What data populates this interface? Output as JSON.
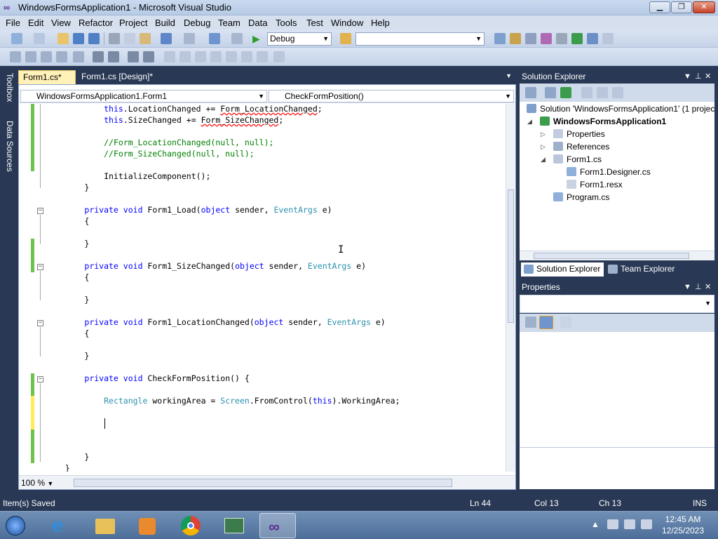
{
  "window": {
    "title": "WindowsFormsApplication1 - Microsoft Visual Studio"
  },
  "menu": [
    "File",
    "Edit",
    "View",
    "Refactor",
    "Project",
    "Build",
    "Debug",
    "Team",
    "Data",
    "Tools",
    "Test",
    "Window",
    "Help"
  ],
  "toolbar": {
    "config": "Debug",
    "platform": ""
  },
  "toolbox_strip": {
    "toolbox": "Toolbox",
    "data_sources": "Data Sources"
  },
  "tabs": [
    {
      "label": "Form1.cs*",
      "active": true
    },
    {
      "label": "Form1.cs [Design]*",
      "active": false
    }
  ],
  "navbar": {
    "type": "WindowsFormsApplication1.Form1",
    "member": "CheckFormPosition()"
  },
  "code": {
    "lines": [
      [
        [
          "            "
        ],
        [
          "this",
          "kw"
        ],
        [
          ".LocationChanged += "
        ],
        [
          "Form_LocationChanged",
          "sq"
        ],
        [
          ";"
        ]
      ],
      [
        [
          "            "
        ],
        [
          "this",
          "kw"
        ],
        [
          ".SizeChanged += "
        ],
        [
          "Form_SizeChanged",
          "sq"
        ],
        [
          ";"
        ]
      ],
      [
        [
          ""
        ]
      ],
      [
        [
          "            "
        ],
        [
          "//Form_LocationChanged(null, null);",
          "cm"
        ]
      ],
      [
        [
          "            "
        ],
        [
          "//Form_SizeChanged(null, null);",
          "cm"
        ]
      ],
      [
        [
          ""
        ]
      ],
      [
        [
          "            InitializeComponent();"
        ]
      ],
      [
        [
          "        }"
        ]
      ],
      [
        [
          ""
        ]
      ],
      [
        [
          "        "
        ],
        [
          "private",
          "kw"
        ],
        [
          " "
        ],
        [
          "void",
          "kw"
        ],
        [
          " Form1_Load("
        ],
        [
          "object",
          "kw"
        ],
        [
          " sender, "
        ],
        [
          "EventArgs",
          "ty"
        ],
        [
          " e)"
        ]
      ],
      [
        [
          "        {"
        ]
      ],
      [
        [
          ""
        ]
      ],
      [
        [
          "        }"
        ]
      ],
      [
        [
          ""
        ]
      ],
      [
        [
          "        "
        ],
        [
          "private",
          "kw"
        ],
        [
          " "
        ],
        [
          "void",
          "kw"
        ],
        [
          " Form1_SizeChanged("
        ],
        [
          "object",
          "kw"
        ],
        [
          " sender, "
        ],
        [
          "EventArgs",
          "ty"
        ],
        [
          " e)"
        ]
      ],
      [
        [
          "        {"
        ]
      ],
      [
        [
          ""
        ]
      ],
      [
        [
          "        }"
        ]
      ],
      [
        [
          ""
        ]
      ],
      [
        [
          "        "
        ],
        [
          "private",
          "kw"
        ],
        [
          " "
        ],
        [
          "void",
          "kw"
        ],
        [
          " Form1_LocationChanged("
        ],
        [
          "object",
          "kw"
        ],
        [
          " sender, "
        ],
        [
          "EventArgs",
          "ty"
        ],
        [
          " e)"
        ]
      ],
      [
        [
          "        {"
        ]
      ],
      [
        [
          ""
        ]
      ],
      [
        [
          "        }"
        ]
      ],
      [
        [
          ""
        ]
      ],
      [
        [
          "        "
        ],
        [
          "private",
          "kw"
        ],
        [
          " "
        ],
        [
          "void",
          "kw"
        ],
        [
          " CheckFormPosition() {"
        ]
      ],
      [
        [
          ""
        ]
      ],
      [
        [
          "            "
        ],
        [
          "Rectangle",
          "ty"
        ],
        [
          " workingArea = "
        ],
        [
          "Screen",
          "ty"
        ],
        [
          ".FromControl("
        ],
        [
          "this",
          "kw"
        ],
        [
          ").WorkingArea;"
        ]
      ],
      [
        [
          ""
        ]
      ],
      [
        [
          "            "
        ]
      ],
      [
        [
          ""
        ]
      ],
      [
        [
          ""
        ]
      ],
      [
        [
          "        }"
        ]
      ],
      [
        [
          "    }"
        ]
      ]
    ]
  },
  "zoom": "100 %",
  "solution_explorer": {
    "title": "Solution Explorer",
    "nodes": [
      {
        "label": "Solution 'WindowsFormsApplication1' (1 project)",
        "depth": 0,
        "icon": "solution-icon",
        "expander": ""
      },
      {
        "label": "WindowsFormsApplication1",
        "depth": 1,
        "icon": "csharp-project-icon",
        "expander": "expanded",
        "bold": true
      },
      {
        "label": "Properties",
        "depth": 2,
        "icon": "properties-folder-icon",
        "expander": "collapsed"
      },
      {
        "label": "References",
        "depth": 2,
        "icon": "references-icon",
        "expander": "collapsed"
      },
      {
        "label": "Form1.cs",
        "depth": 2,
        "icon": "form-icon",
        "expander": "expanded"
      },
      {
        "label": "Form1.Designer.cs",
        "depth": 3,
        "icon": "csharp-file-icon",
        "expander": ""
      },
      {
        "label": "Form1.resx",
        "depth": 3,
        "icon": "resx-file-icon",
        "expander": ""
      },
      {
        "label": "Program.cs",
        "depth": 2,
        "icon": "csharp-file-icon",
        "expander": ""
      }
    ],
    "bottom_tabs": [
      "Solution Explorer",
      "Team Explorer"
    ]
  },
  "properties": {
    "title": "Properties"
  },
  "status": {
    "message": "Item(s) Saved",
    "ln": "Ln 44",
    "col": "Col 13",
    "ch": "Ch 13",
    "mode": "INS"
  },
  "taskbar": {
    "apps": [
      "start-orb-icon",
      "internet-explorer-icon",
      "file-explorer-icon",
      "media-player-icon",
      "chrome-icon",
      "network-tool-icon",
      "visual-studio-icon"
    ],
    "time": "12:45 AM",
    "date": "12/25/2023"
  },
  "colors": {
    "accent": "#293955",
    "active_tab": "#fff1b8",
    "keyword": "#0000ff",
    "type": "#2b91af",
    "comment": "#008000"
  }
}
